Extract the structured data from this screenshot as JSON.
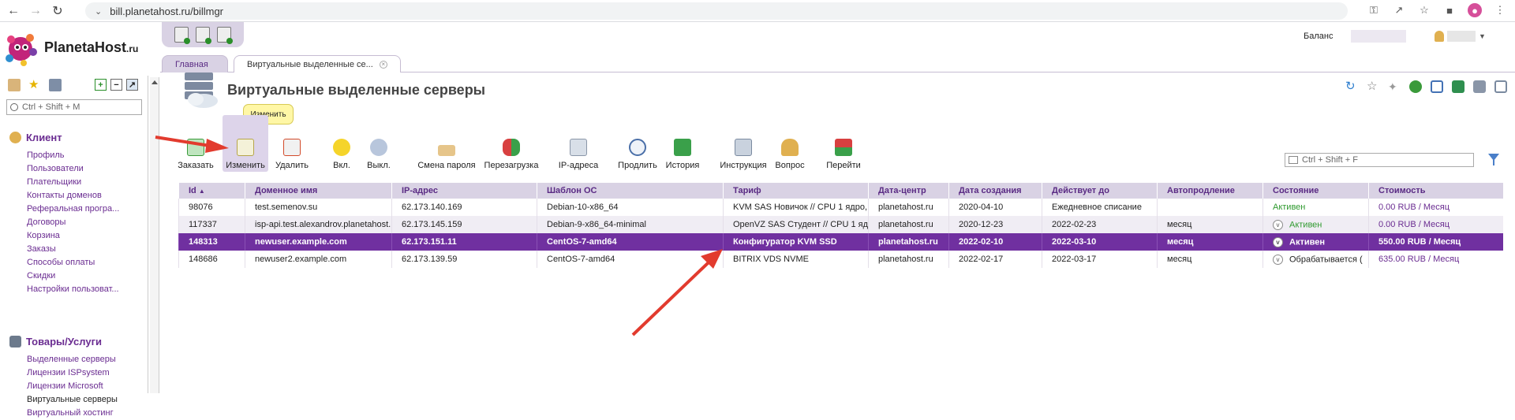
{
  "browser": {
    "url": "bill.planetahost.ru/billmgr",
    "nav": {
      "back_icon": "arrow-left-icon",
      "forward_icon": "arrow-right-icon",
      "reload_icon": "reload-icon"
    }
  },
  "brand": {
    "name": "PlanetaHost",
    "suffix": ".ru",
    "accent": "#7030a0"
  },
  "header": {
    "balance_label": "Баланс"
  },
  "tabs": [
    {
      "label": "Главная"
    },
    {
      "label": "Виртуальные выделенные се..."
    }
  ],
  "sidebar": {
    "search_placeholder": "Ctrl + Shift + M",
    "sections": [
      {
        "title": "Клиент",
        "items": [
          "Профиль",
          "Пользователи",
          "Плательщики",
          "Контакты доменов",
          "Реферальная програ...",
          "Договоры",
          "Корзина",
          "Заказы",
          "Способы оплаты",
          "Скидки",
          "Настройки пользоват..."
        ]
      },
      {
        "title": "Товары/Услуги",
        "items": [
          "Выделенные серверы",
          "Лицензии ISPsystem",
          "Лицензии Microsoft",
          "Виртуальные серверы",
          "Виртуальный хостинг"
        ]
      }
    ]
  },
  "page": {
    "title": "Виртуальные выделенные серверы",
    "tooltip": "Изменить",
    "search_placeholder": "Ctrl + Shift + F"
  },
  "toolbar": [
    {
      "label": "Заказать",
      "icon": "order-icon"
    },
    {
      "label": "Изменить",
      "icon": "edit-icon"
    },
    {
      "label": "Удалить",
      "icon": "delete-icon"
    },
    {
      "label": "Вкл.",
      "icon": "bulb-on-icon"
    },
    {
      "label": "Выкл.",
      "icon": "bulb-off-icon"
    },
    {
      "label": "Смена пароля",
      "icon": "key-icon"
    },
    {
      "label": "Перезагрузка",
      "icon": "reboot-icon"
    },
    {
      "label": "IP-адреса",
      "icon": "ip-icon"
    },
    {
      "label": "Продлить",
      "icon": "clock-icon"
    },
    {
      "label": "История",
      "icon": "history-icon"
    },
    {
      "label": "Инструкция",
      "icon": "manual-icon"
    },
    {
      "label": "Вопрос",
      "icon": "question-icon"
    },
    {
      "label": "Перейти",
      "icon": "goto-icon"
    }
  ],
  "table": {
    "columns": [
      "Id",
      "Доменное имя",
      "IP-адрес",
      "Шаблон ОС",
      "Тариф",
      "Дата-центр",
      "Дата создания",
      "Действует до",
      "Автопродление",
      "Состояние",
      "Стоимость"
    ],
    "sort_indicator": "▲",
    "rows": [
      {
        "id": "98076",
        "domain": "test.semenov.su",
        "ip": "62.173.140.169",
        "os": "Debian-10-x86_64",
        "tariff": "KVM SAS Новичок // CPU 1 ядро,",
        "dc": "planetahost.ru",
        "created": "2020-04-10",
        "until": "Ежедневное списание",
        "autorenew": "",
        "status": "Активен",
        "cost": "0.00 RUB / Месяц",
        "status_icon": false
      },
      {
        "id": "117337",
        "domain": "isp-api.test.alexandrov.planetahost.",
        "ip": "62.173.145.159",
        "os": "Debian-9-x86_64-minimal",
        "tariff": "OpenVZ SAS Студент // CPU 1 яд",
        "dc": "planetahost.ru",
        "created": "2020-12-23",
        "until": "2022-02-23",
        "autorenew": "месяц",
        "status": "Активен",
        "cost": "0.00 RUB / Месяц",
        "status_icon": true
      },
      {
        "id": "148313",
        "domain": "newuser.example.com",
        "ip": "62.173.151.11",
        "os": "CentOS-7-amd64",
        "tariff": "Конфигуратор KVM SSD",
        "dc": "planetahost.ru",
        "created": "2022-02-10",
        "until": "2022-03-10",
        "autorenew": "месяц",
        "status": "Активен",
        "cost": "550.00 RUB / Месяц",
        "status_icon": true
      },
      {
        "id": "148686",
        "domain": "newuser2.example.com",
        "ip": "62.173.139.59",
        "os": "CentOS-7-amd64",
        "tariff": "BITRIX VDS NVME",
        "dc": "planetahost.ru",
        "created": "2022-02-17",
        "until": "2022-03-17",
        "autorenew": "месяц",
        "status": "Обрабатывается (",
        "cost": "635.00 RUB / Месяц",
        "status_icon": true
      }
    ]
  }
}
